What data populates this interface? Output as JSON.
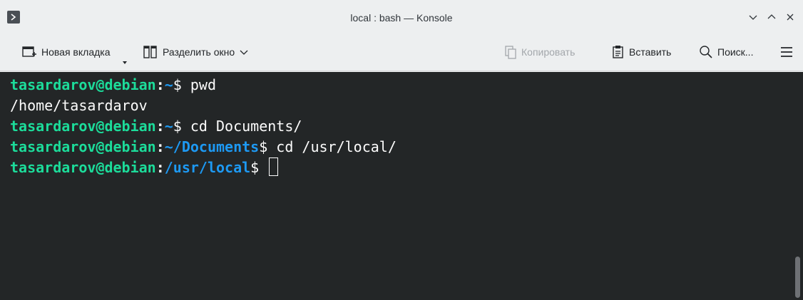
{
  "window": {
    "title": "local : bash — Konsole"
  },
  "toolbar": {
    "new_tab_label": "Новая вкладка",
    "split_label": "Разделить окно",
    "copy_label": "Копировать",
    "paste_label": "Вставить",
    "search_label": "Поиск..."
  },
  "terminal": {
    "lines": [
      {
        "user": "tasardarov@debian",
        "sep": ":",
        "path": "~",
        "prompt": "$ ",
        "command": "pwd"
      },
      {
        "output": "/home/tasardarov"
      },
      {
        "user": "tasardarov@debian",
        "sep": ":",
        "path": "~",
        "prompt": "$ ",
        "command": "cd Documents/"
      },
      {
        "user": "tasardarov@debian",
        "sep": ":",
        "path": "~/Documents",
        "prompt": "$ ",
        "command": "cd /usr/local/"
      },
      {
        "user": "tasardarov@debian",
        "sep": ":",
        "path": "/usr/local",
        "prompt": "$ ",
        "command": ""
      }
    ]
  },
  "colors": {
    "terminal_bg": "#232627",
    "user": "#1cdc9a",
    "path": "#1d99f3",
    "text": "#fcfcfc"
  },
  "icons": {
    "app": "konsole-icon",
    "minimize": "chevron-down-icon",
    "maximize": "chevron-up-icon",
    "close": "close-icon",
    "new_tab": "new-tab-icon",
    "split": "split-view-icon",
    "copy": "copy-icon",
    "paste": "paste-icon",
    "search": "search-icon",
    "menu": "hamburger-menu-icon"
  }
}
